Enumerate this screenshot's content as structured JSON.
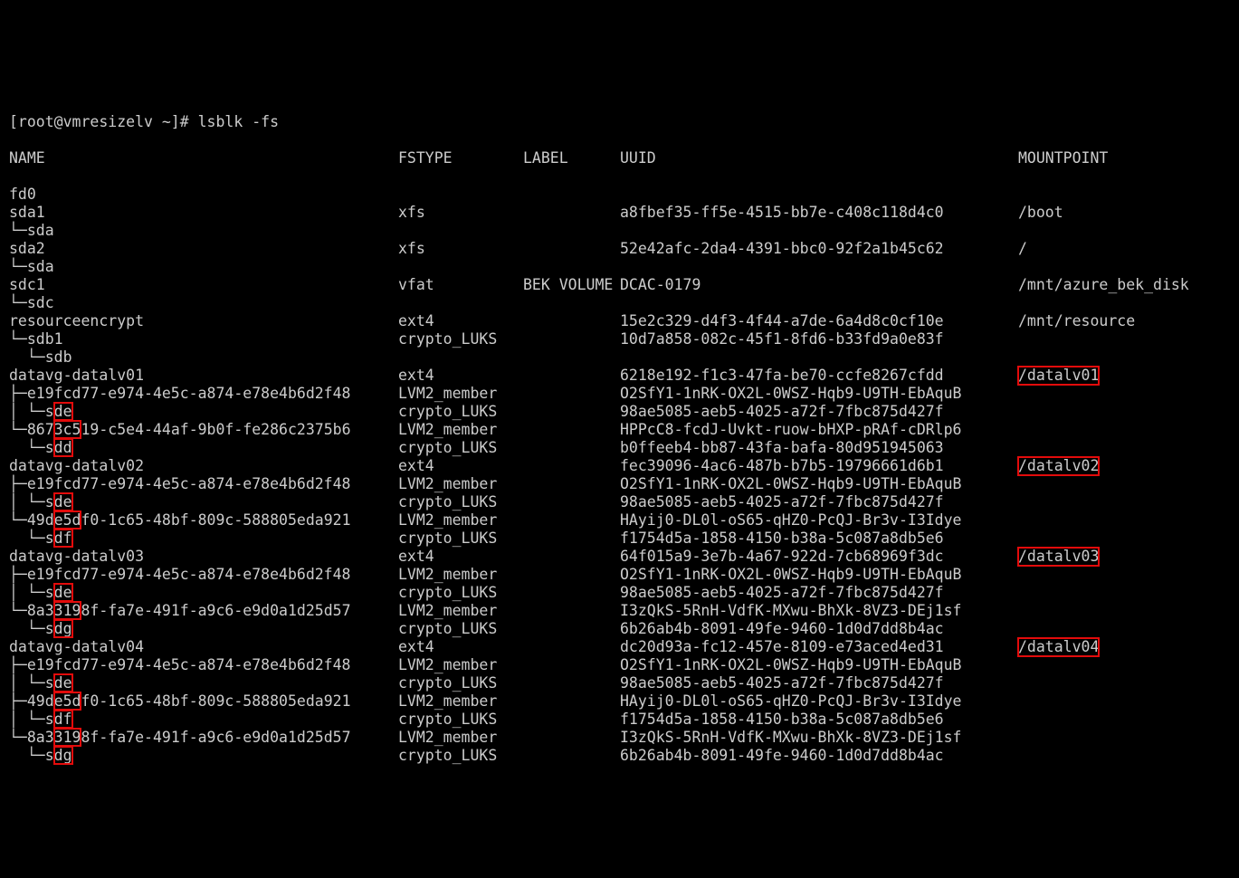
{
  "prompt": "[root@vmresizelv ~]# lsblk -fs",
  "headers": {
    "name": "NAME",
    "fstype": "FSTYPE",
    "label": "LABEL",
    "uuid": "UUID",
    "mount": "MOUNTPOINT"
  },
  "rows": [
    {
      "name": "fd0"
    },
    {
      "name": "sda1",
      "fstype": "xfs",
      "uuid": "a8fbef35-ff5e-4515-bb7e-c408c118d4c0",
      "mount": "/boot"
    },
    {
      "name": "└─sda"
    },
    {
      "name": "sda2",
      "fstype": "xfs",
      "uuid": "52e42afc-2da4-4391-bbc0-92f2a1b45c62",
      "mount": "/"
    },
    {
      "name": "└─sda"
    },
    {
      "name": "sdc1",
      "fstype": "vfat",
      "label": "BEK VOLUME",
      "uuid": "DCAC-0179",
      "mount": "/mnt/azure_bek_disk"
    },
    {
      "name": "└─sdc"
    },
    {
      "name": "resourceencrypt",
      "fstype": "ext4",
      "uuid": "15e2c329-d4f3-4f44-a7de-6a4d8c0cf10e",
      "mount": "/mnt/resource"
    },
    {
      "name": "└─sdb1",
      "fstype": "crypto_LUKS",
      "uuid": "10d7a858-082c-45f1-8fd6-b33fd9a0e83f"
    },
    {
      "name": "  └─sdb"
    },
    {
      "name": "datavg-datalv01",
      "fstype": "ext4",
      "uuid": "6218e192-f1c3-47fa-be70-ccfe8267cfdd",
      "mount": "/datalv01",
      "mount_hl": true
    },
    {
      "name": "├─e19fcd77-e974-4e5c-a874-e78e4b6d2f48",
      "fstype": "LVM2_member",
      "uuid": "O2SfY1-1nRK-OX2L-0WSZ-Hqb9-U9TH-EbAquB"
    },
    {
      "name": "│ └─sde",
      "fstype": "crypto_LUKS",
      "uuid": "98ae5085-aeb5-4025-a72f-7fbc875d427f",
      "hl": [
        5,
        8
      ]
    },
    {
      "name": "└─8673c519-c5e4-44af-9b0f-fe286c2375b6",
      "fstype": "LVM2_member",
      "uuid": "HPPcC8-fcdJ-Uvkt-ruow-bHXP-pRAf-cDRlp6",
      "hl": [
        5,
        8
      ]
    },
    {
      "name": "  └─sdd",
      "fstype": "crypto_LUKS",
      "uuid": "b0ffeeb4-bb87-43fa-bafa-80d951945063",
      "hl": [
        5,
        8
      ]
    },
    {
      "name": "datavg-datalv02",
      "fstype": "ext4",
      "uuid": "fec39096-4ac6-487b-b7b5-19796661d6b1",
      "mount": "/datalv02",
      "mount_hl": true
    },
    {
      "name": "├─e19fcd77-e974-4e5c-a874-e78e4b6d2f48",
      "fstype": "LVM2_member",
      "uuid": "O2SfY1-1nRK-OX2L-0WSZ-Hqb9-U9TH-EbAquB"
    },
    {
      "name": "│ └─sde",
      "fstype": "crypto_LUKS",
      "uuid": "98ae5085-aeb5-4025-a72f-7fbc875d427f",
      "hl": [
        5,
        8
      ]
    },
    {
      "name": "└─49de5df0-1c65-48bf-809c-588805eda921",
      "fstype": "LVM2_member",
      "uuid": "HAyij0-DL0l-oS65-qHZ0-PcQJ-Br3v-I3Idye",
      "hl": [
        5,
        8
      ]
    },
    {
      "name": "  └─sdf",
      "fstype": "crypto_LUKS",
      "uuid": "f1754d5a-1858-4150-b38a-5c087a8db5e6",
      "hl": [
        5,
        8
      ]
    },
    {
      "name": "datavg-datalv03",
      "fstype": "ext4",
      "uuid": "64f015a9-3e7b-4a67-922d-7cb68969f3dc",
      "mount": "/datalv03",
      "mount_hl": true
    },
    {
      "name": "├─e19fcd77-e974-4e5c-a874-e78e4b6d2f48",
      "fstype": "LVM2_member",
      "uuid": "O2SfY1-1nRK-OX2L-0WSZ-Hqb9-U9TH-EbAquB"
    },
    {
      "name": "│ └─sde",
      "fstype": "crypto_LUKS",
      "uuid": "98ae5085-aeb5-4025-a72f-7fbc875d427f",
      "hl": [
        5,
        8
      ]
    },
    {
      "name": "└─8a33198f-fa7e-491f-a9c6-e9d0a1d25d57",
      "fstype": "LVM2_member",
      "uuid": "I3zQkS-5RnH-VdfK-MXwu-BhXk-8VZ3-DEj1sf",
      "hl": [
        5,
        8
      ]
    },
    {
      "name": "  └─sdg",
      "fstype": "crypto_LUKS",
      "uuid": "6b26ab4b-8091-49fe-9460-1d0d7dd8b4ac",
      "hl": [
        5,
        8
      ]
    },
    {
      "name": "datavg-datalv04",
      "fstype": "ext4",
      "uuid": "dc20d93a-fc12-457e-8109-e73aced4ed31",
      "mount": "/datalv04",
      "mount_hl": true
    },
    {
      "name": "├─e19fcd77-e974-4e5c-a874-e78e4b6d2f48",
      "fstype": "LVM2_member",
      "uuid": "O2SfY1-1nRK-OX2L-0WSZ-Hqb9-U9TH-EbAquB"
    },
    {
      "name": "│ └─sde",
      "fstype": "crypto_LUKS",
      "uuid": "98ae5085-aeb5-4025-a72f-7fbc875d427f",
      "hl": [
        5,
        8
      ]
    },
    {
      "name": "├─49de5df0-1c65-48bf-809c-588805eda921",
      "fstype": "LVM2_member",
      "uuid": "HAyij0-DL0l-oS65-qHZ0-PcQJ-Br3v-I3Idye",
      "hl": [
        5,
        8
      ]
    },
    {
      "name": "│ └─sdf",
      "fstype": "crypto_LUKS",
      "uuid": "f1754d5a-1858-4150-b38a-5c087a8db5e6",
      "hl": [
        5,
        8
      ]
    },
    {
      "name": "└─8a33198f-fa7e-491f-a9c6-e9d0a1d25d57",
      "fstype": "LVM2_member",
      "uuid": "I3zQkS-5RnH-VdfK-MXwu-BhXk-8VZ3-DEj1sf",
      "hl": [
        5,
        8
      ]
    },
    {
      "name": "  └─sdg",
      "fstype": "crypto_LUKS",
      "uuid": "6b26ab4b-8091-49fe-9460-1d0d7dd8b4ac",
      "hl": [
        5,
        8
      ]
    }
  ]
}
